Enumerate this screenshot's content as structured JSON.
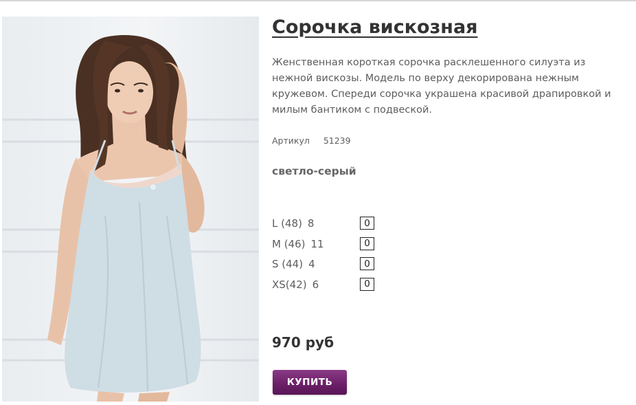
{
  "product": {
    "title": "Сорочка вискозная",
    "description": "Женственная короткая сорочка расклешенного силуэта из нежной вискозы. Модель по верху декорирована нежным кружевом. Спереди сорочка украшена красивой драпировкой и милым бантиком с подвеской.",
    "sku_label": "Артикул",
    "sku_value": "51239",
    "color": "светло-серый",
    "sizes": [
      {
        "label": "L (48)",
        "stock": "8",
        "qty": "0"
      },
      {
        "label": "M (46)",
        "stock": "11",
        "qty": "0"
      },
      {
        "label": "S (44)",
        "stock": "4",
        "qty": "0"
      },
      {
        "label": "XS(42)",
        "stock": "6",
        "qty": "0"
      }
    ],
    "price": "970 руб",
    "buy_label": "КУПИТЬ"
  },
  "colors": {
    "accent": "#6a1f66",
    "title": "#333333",
    "text": "#5d5d5d",
    "garment": "#cfdde5"
  }
}
